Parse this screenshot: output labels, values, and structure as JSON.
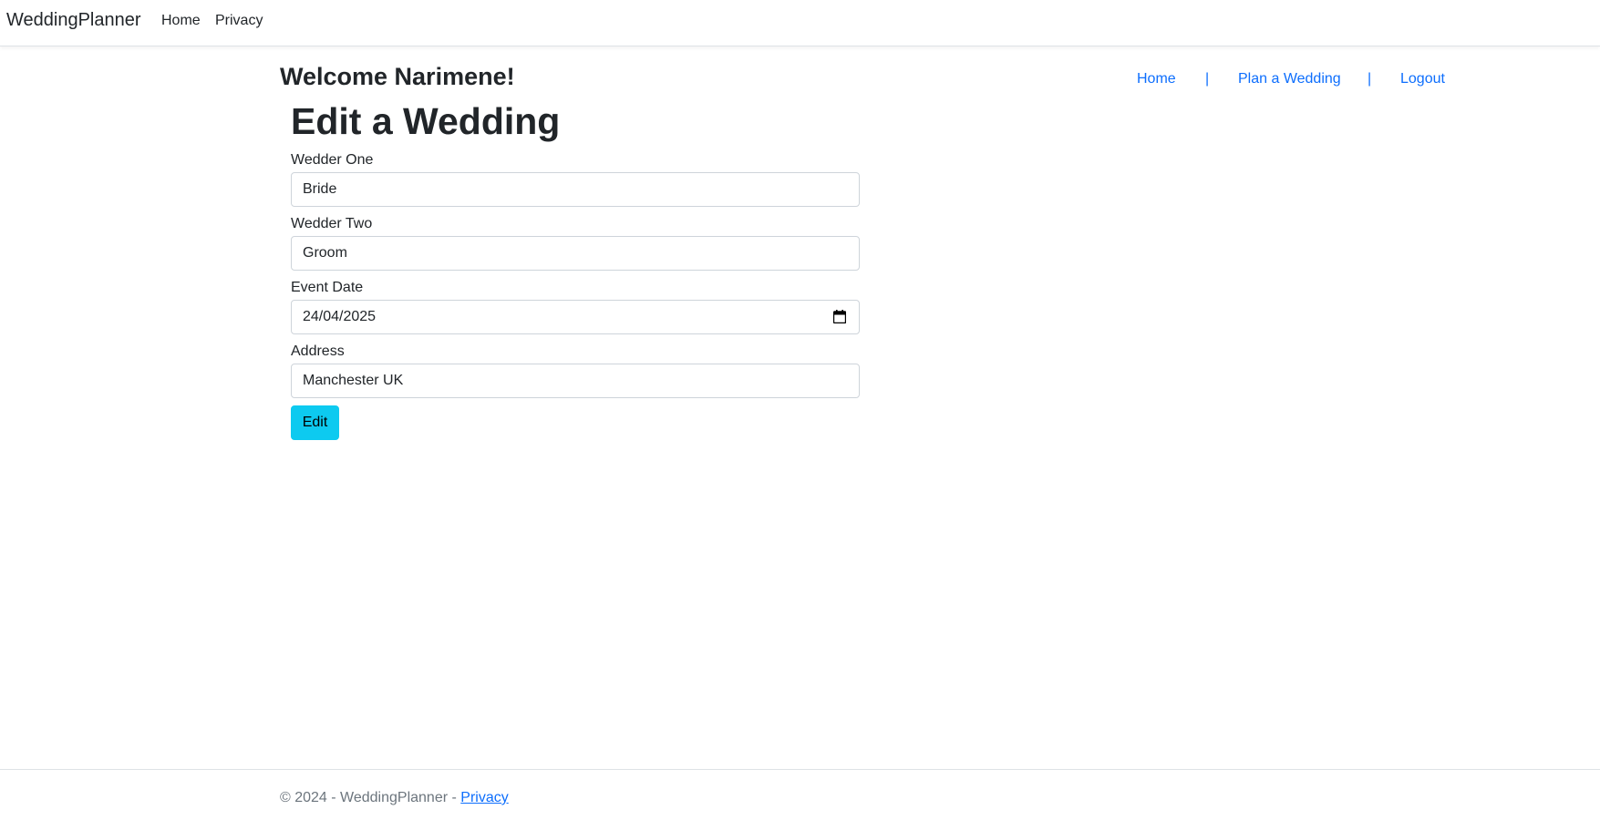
{
  "navbar": {
    "brand": "WeddingPlanner",
    "links": [
      "Home",
      "Privacy"
    ]
  },
  "header": {
    "welcome": "Welcome Narimene!",
    "links": {
      "home": "Home",
      "plan": "Plan a Wedding",
      "logout": "Logout",
      "separator": "|"
    }
  },
  "form": {
    "title": "Edit a Wedding",
    "fields": {
      "wedder_one": {
        "label": "Wedder One",
        "value": "Bride"
      },
      "wedder_two": {
        "label": "Wedder Two",
        "value": "Groom"
      },
      "event_date": {
        "label": "Event Date",
        "value": "24/04/2025"
      },
      "address": {
        "label": "Address",
        "value": "Manchester UK"
      }
    },
    "submit_label": "Edit"
  },
  "footer": {
    "text": "© 2024 - WeddingPlanner - ",
    "privacy_link": "Privacy"
  },
  "colors": {
    "link": "#0d6efd",
    "button": "#0dcaf0",
    "muted": "#6c757d"
  },
  "icons": {
    "date_picker": "calendar-icon"
  }
}
